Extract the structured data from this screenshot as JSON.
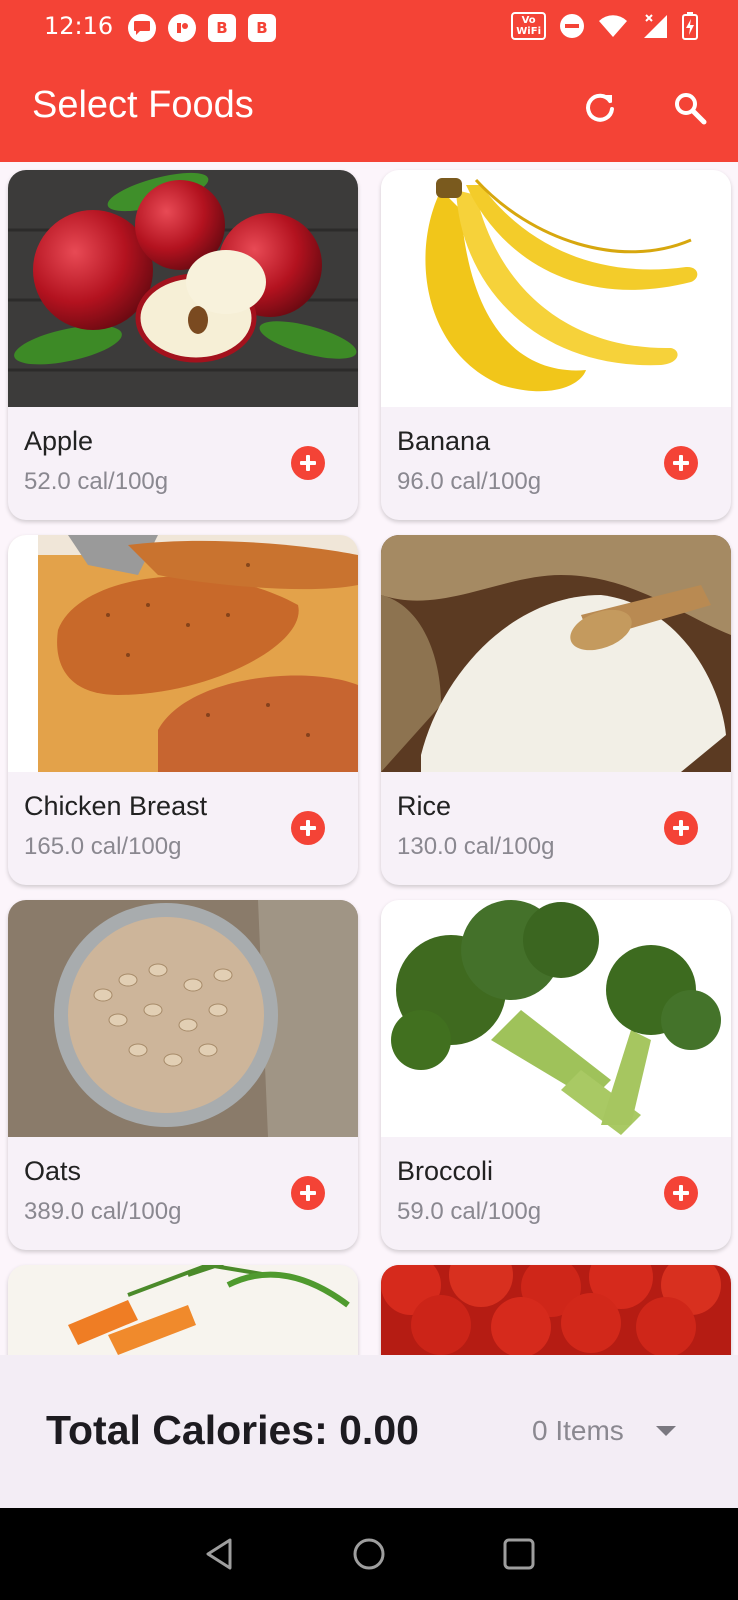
{
  "status_bar": {
    "time": "12:16",
    "left_icons": [
      "message-icon",
      "app-icon",
      "b-icon",
      "b-icon"
    ],
    "badge_b": "B",
    "volte_top": "Vo",
    "volte_bottom": "WiFi"
  },
  "app_bar": {
    "title": "Select Foods",
    "actions": [
      "refresh-icon",
      "search-icon"
    ]
  },
  "foods": [
    {
      "name": "Apple",
      "calories": "52.0 cal/100g"
    },
    {
      "name": "Banana",
      "calories": "96.0 cal/100g"
    },
    {
      "name": "Chicken Breast",
      "calories": "165.0 cal/100g"
    },
    {
      "name": "Rice",
      "calories": "130.0 cal/100g"
    },
    {
      "name": "Oats",
      "calories": "389.0 cal/100g"
    },
    {
      "name": "Broccoli",
      "calories": "59.0 cal/100g"
    }
  ],
  "summary": {
    "total_label": "Total Calories: 0.00",
    "items_label": "0 Items"
  },
  "colors": {
    "primary": "#f44336",
    "surface": "#f7f1f8",
    "background": "#fcf5fb"
  }
}
